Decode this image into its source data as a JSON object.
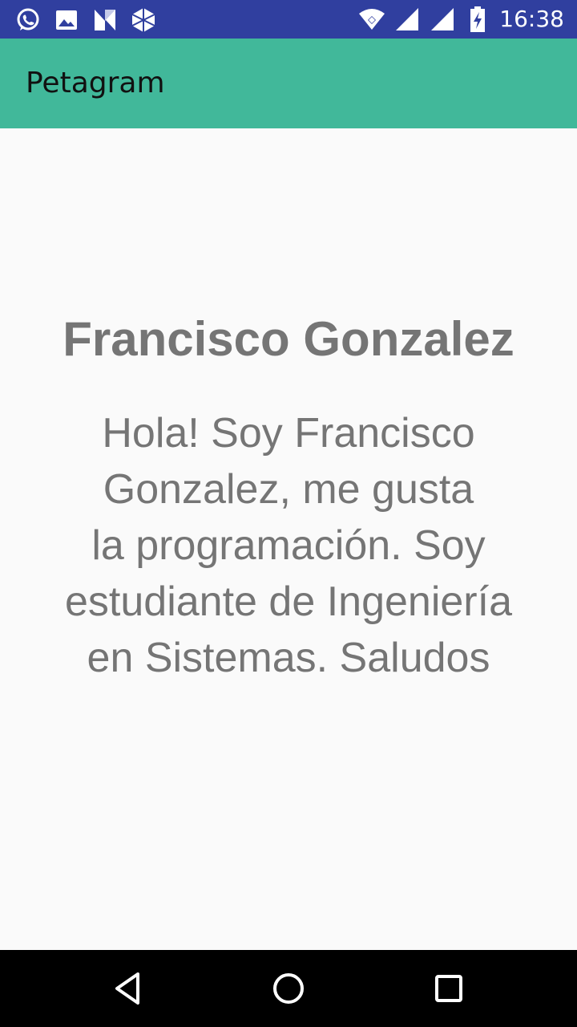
{
  "status_bar": {
    "time": "16:38",
    "color": "#303f9f",
    "left_icons": [
      "whatsapp-icon",
      "gallery-icon",
      "n-app-icon",
      "dropbox-icon"
    ],
    "right_icons": [
      "wifi-icon",
      "signal-icon",
      "signal-icon",
      "battery-charging-icon"
    ]
  },
  "app_bar": {
    "title": "Petagram",
    "color": "#41b89a"
  },
  "profile": {
    "name": "Francisco Gonzalez",
    "bio_lines": [
      "Hola! Soy Francisco",
      "Gonzalez, me gusta",
      "la programación. Soy",
      "estudiante de Ingeniería",
      "en Sistemas. Saludos"
    ],
    "text_color": "#757575"
  },
  "nav_bar": {
    "buttons": [
      "back-icon",
      "home-icon",
      "recents-icon"
    ]
  }
}
